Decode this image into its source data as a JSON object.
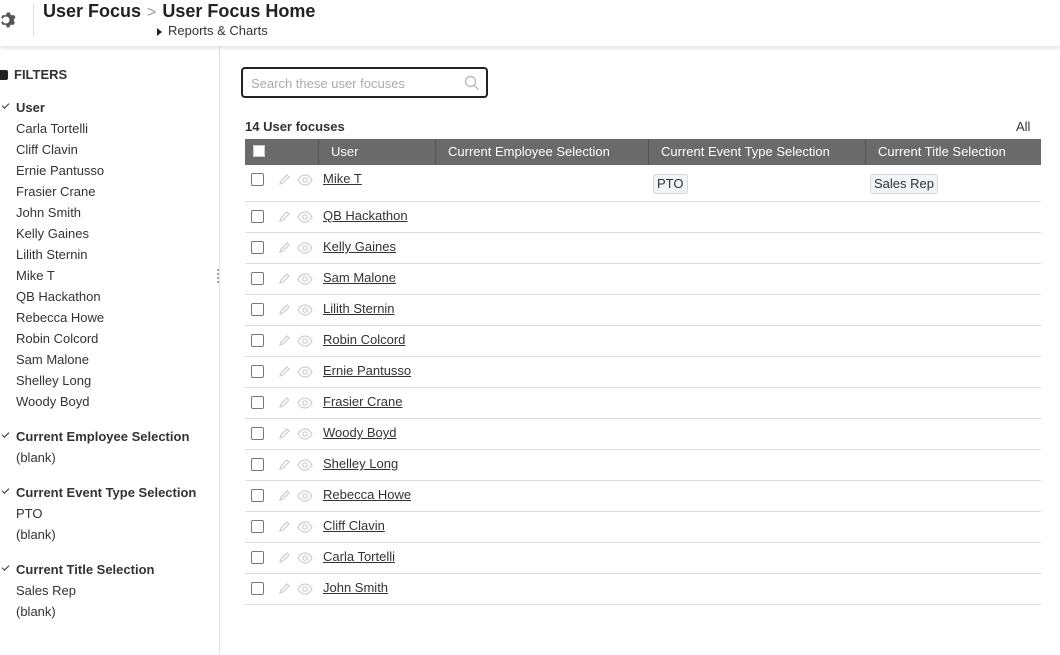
{
  "header": {
    "breadcrumb_root": "User Focus",
    "breadcrumb_separator": ">",
    "breadcrumb_current": "User Focus Home",
    "subnav_label": "Reports & Charts"
  },
  "sidebar": {
    "filters_title": "FILTERS",
    "groups": [
      {
        "title": "User",
        "items": [
          "Carla Tortelli",
          "Cliff Clavin",
          "Ernie Pantusso",
          "Frasier Crane",
          "John Smith",
          "Kelly Gaines",
          "Lilith Sternin",
          "Mike T",
          "QB Hackathon",
          "Rebecca Howe",
          "Robin Colcord",
          "Sam Malone",
          "Shelley Long",
          "Woody Boyd"
        ]
      },
      {
        "title": "Current Employee Selection",
        "items": [
          "(blank)"
        ]
      },
      {
        "title": "Current Event Type Selection",
        "items": [
          "PTO",
          "(blank)"
        ]
      },
      {
        "title": "Current Title Selection",
        "items": [
          "Sales Rep",
          "(blank)"
        ]
      }
    ]
  },
  "search": {
    "placeholder": "Search these user focuses",
    "value": ""
  },
  "list": {
    "count_label": "14 User focuses",
    "all_label": "All",
    "columns": [
      "",
      "User",
      "Current Employee Selection",
      "Current Event Type Selection",
      "Current Title Selection"
    ],
    "rows": [
      {
        "user": "Mike T",
        "employee": "",
        "event_type": "PTO",
        "title": "Sales Rep"
      },
      {
        "user": "QB Hackathon",
        "employee": "",
        "event_type": "",
        "title": ""
      },
      {
        "user": "Kelly Gaines",
        "employee": "",
        "event_type": "",
        "title": ""
      },
      {
        "user": "Sam Malone",
        "employee": "",
        "event_type": "",
        "title": ""
      },
      {
        "user": "Lilith Sternin",
        "employee": "",
        "event_type": "",
        "title": ""
      },
      {
        "user": "Robin Colcord",
        "employee": "",
        "event_type": "",
        "title": ""
      },
      {
        "user": "Ernie Pantusso",
        "employee": "",
        "event_type": "",
        "title": ""
      },
      {
        "user": "Frasier Crane",
        "employee": "",
        "event_type": "",
        "title": ""
      },
      {
        "user": "Woody Boyd",
        "employee": "",
        "event_type": "",
        "title": ""
      },
      {
        "user": "Shelley Long",
        "employee": "",
        "event_type": "",
        "title": ""
      },
      {
        "user": "Rebecca Howe",
        "employee": "",
        "event_type": "",
        "title": ""
      },
      {
        "user": "Cliff Clavin",
        "employee": "",
        "event_type": "",
        "title": ""
      },
      {
        "user": "Carla Tortelli",
        "employee": "",
        "event_type": "",
        "title": ""
      },
      {
        "user": "John Smith",
        "employee": "",
        "event_type": "",
        "title": ""
      }
    ]
  },
  "icons": {
    "gear": "gear-icon",
    "search": "search-icon",
    "edit": "pencil-icon",
    "view": "eye-icon"
  },
  "colors": {
    "table_header_bg": "#6a6a6a",
    "tag_bg": "#f1f3f6"
  }
}
